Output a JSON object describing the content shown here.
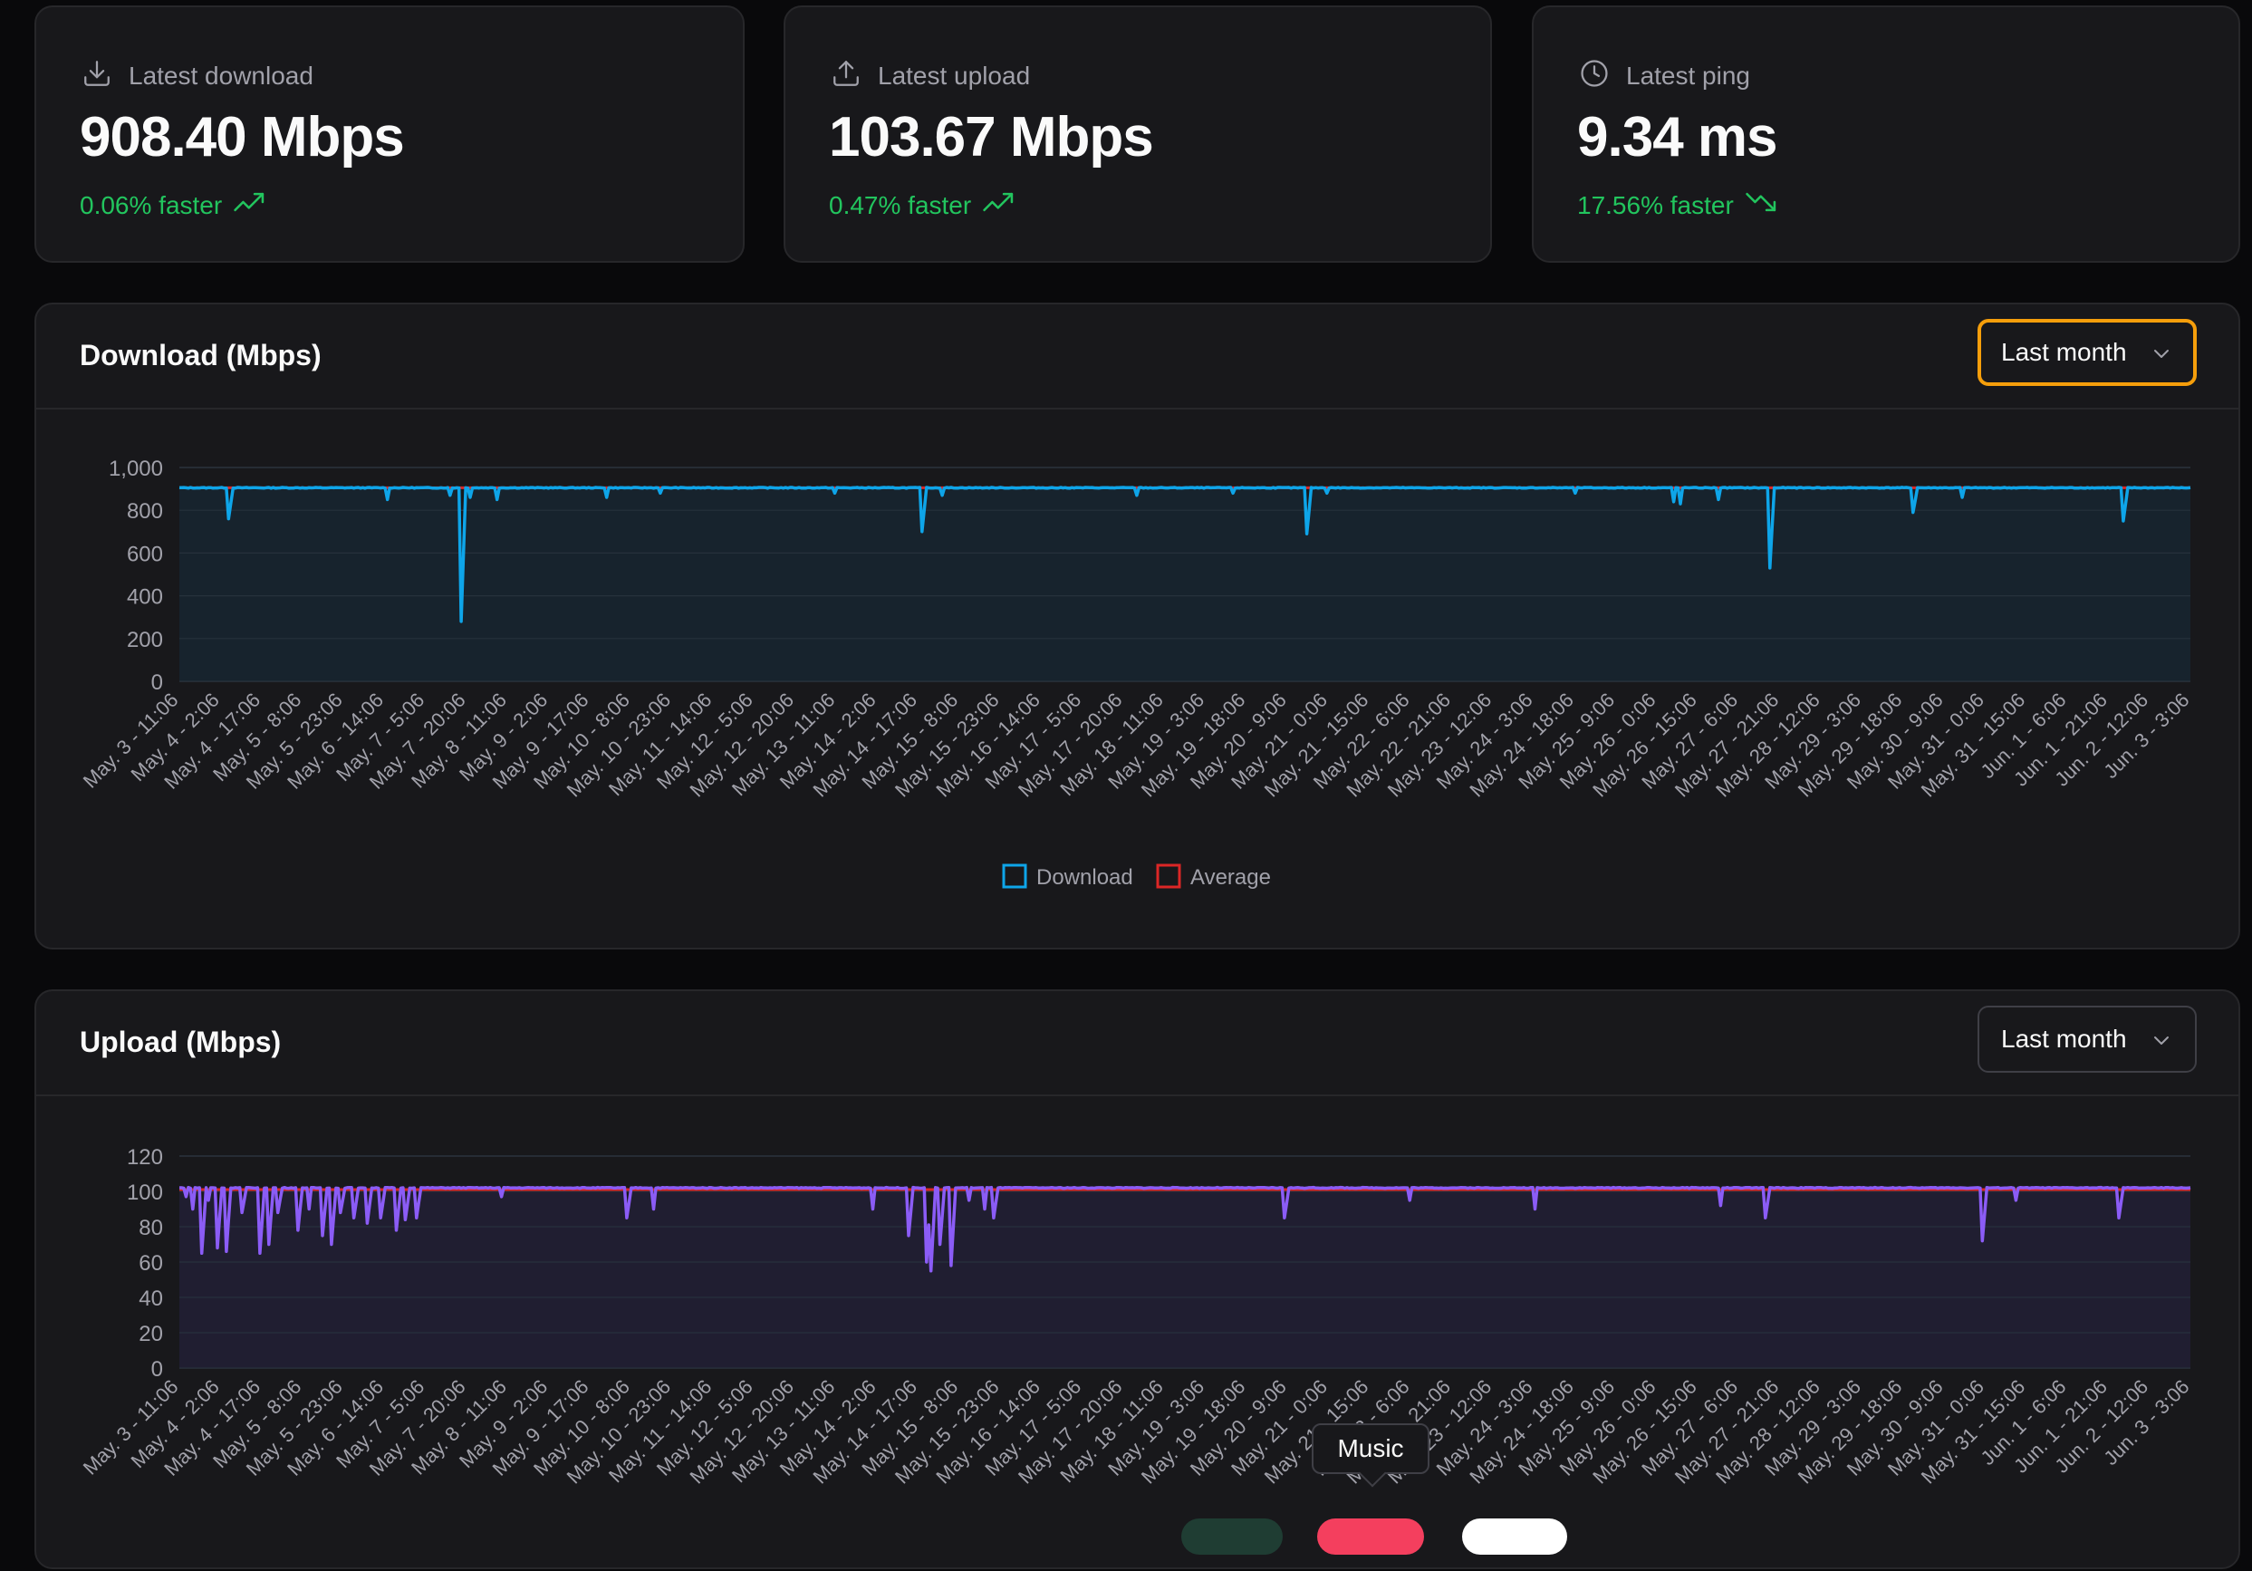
{
  "stats": [
    {
      "label": "Latest download",
      "value": "908.40 Mbps",
      "delta": "0.06% faster",
      "icon": "download-icon",
      "trend": "up"
    },
    {
      "label": "Latest upload",
      "value": "103.67 Mbps",
      "delta": "0.47% faster",
      "icon": "upload-icon",
      "trend": "up"
    },
    {
      "label": "Latest ping",
      "value": "9.34 ms",
      "delta": "17.56% faster",
      "icon": "clock-icon",
      "trend": "down"
    }
  ],
  "download_card": {
    "title": "Download (Mbps)",
    "range": "Last month"
  },
  "upload_card": {
    "title": "Upload (Mbps)",
    "range": "Last month"
  },
  "tooltip": {
    "text": "Music"
  },
  "colors": {
    "background": "#09090b",
    "card": "#18181b",
    "border": "#27272a",
    "positive": "#22c55e",
    "focus": "#f59e0b",
    "download": "#0ea5e9",
    "upload": "#8b5cf6",
    "average": "#dc2626"
  },
  "chart_data": [
    {
      "type": "line",
      "categories": [
        "May. 3 - 11:06",
        "May. 4 - 2:06",
        "May. 4 - 17:06",
        "May. 5 - 8:06",
        "May. 5 - 23:06",
        "May. 6 - 14:06",
        "May. 7 - 5:06",
        "May. 7 - 20:06",
        "May. 8 - 11:06",
        "May. 9 - 2:06",
        "May. 9 - 17:06",
        "May. 10 - 8:06",
        "May. 10 - 23:06",
        "May. 11 - 14:06",
        "May. 12 - 5:06",
        "May. 12 - 20:06",
        "May. 13 - 11:06",
        "May. 14 - 2:06",
        "May. 14 - 17:06",
        "May. 15 - 8:06",
        "May. 15 - 23:06",
        "May. 16 - 14:06",
        "May. 17 - 5:06",
        "May. 17 - 20:06",
        "May. 18 - 11:06",
        "May. 19 - 3:06",
        "May. 19 - 18:06",
        "May. 20 - 9:06",
        "May. 21 - 0:06",
        "May. 21 - 15:06",
        "May. 22 - 6:06",
        "May. 22 - 21:06",
        "May. 23 - 12:06",
        "May. 24 - 3:06",
        "May. 24 - 18:06",
        "May. 25 - 9:06",
        "May. 26 - 0:06",
        "May. 26 - 15:06",
        "May. 27 - 6:06",
        "May. 27 - 21:06",
        "May. 28 - 12:06",
        "May. 29 - 3:06",
        "May. 29 - 18:06",
        "May. 30 - 9:06",
        "May. 31 - 0:06",
        "May. 31 - 15:06",
        "Jun. 1 - 6:06",
        "Jun. 1 - 21:06",
        "Jun. 2 - 12:06",
        "Jun. 3 - 3:06"
      ],
      "series": [
        {
          "name": "Download",
          "color": "#0ea5e9",
          "baseline": 905,
          "dips": [
            [
              0.024,
              760
            ],
            [
              0.103,
              850
            ],
            [
              0.135,
              870
            ],
            [
              0.14,
              280
            ],
            [
              0.145,
              860
            ],
            [
              0.158,
              850
            ],
            [
              0.213,
              860
            ],
            [
              0.239,
              880
            ],
            [
              0.326,
              880
            ],
            [
              0.369,
              700
            ],
            [
              0.379,
              870
            ],
            [
              0.476,
              870
            ],
            [
              0.524,
              880
            ],
            [
              0.561,
              690
            ],
            [
              0.571,
              880
            ],
            [
              0.694,
              880
            ],
            [
              0.743,
              840
            ],
            [
              0.746,
              830
            ],
            [
              0.765,
              850
            ],
            [
              0.791,
              530
            ],
            [
              0.862,
              790
            ],
            [
              0.887,
              860
            ],
            [
              0.967,
              750
            ]
          ]
        },
        {
          "name": "Average",
          "color": "#dc2626",
          "value": 905
        }
      ],
      "ylim": [
        0,
        1000
      ],
      "yticks": [
        "0",
        "200",
        "400",
        "600",
        "800",
        "1,000"
      ],
      "legend": "bottom-center",
      "grid": true
    },
    {
      "type": "line",
      "categories": [
        "May. 3 - 11:06",
        "May. 4 - 2:06",
        "May. 4 - 17:06",
        "May. 5 - 8:06",
        "May. 5 - 23:06",
        "May. 6 - 14:06",
        "May. 7 - 5:06",
        "May. 7 - 20:06",
        "May. 8 - 11:06",
        "May. 9 - 2:06",
        "May. 9 - 17:06",
        "May. 10 - 8:06",
        "May. 10 - 23:06",
        "May. 11 - 14:06",
        "May. 12 - 5:06",
        "May. 12 - 20:06",
        "May. 13 - 11:06",
        "May. 14 - 2:06",
        "May. 14 - 17:06",
        "May. 15 - 8:06",
        "May. 15 - 23:06",
        "May. 16 - 14:06",
        "May. 17 - 5:06",
        "May. 17 - 20:06",
        "May. 18 - 11:06",
        "May. 19 - 3:06",
        "May. 19 - 18:06",
        "May. 20 - 9:06",
        "May. 21 - 0:06",
        "May. 21 - 15:06",
        "May. 22 - 6:06",
        "May. 22 - 21:06",
        "May. 23 - 12:06",
        "May. 24 - 3:06",
        "May. 24 - 18:06",
        "May. 25 - 9:06",
        "May. 26 - 0:06",
        "May. 26 - 15:06",
        "May. 27 - 6:06",
        "May. 27 - 21:06",
        "May. 28 - 12:06",
        "May. 29 - 3:06",
        "May. 29 - 18:06",
        "May. 30 - 9:06",
        "May. 31 - 0:06",
        "May. 31 - 15:06",
        "Jun. 1 - 6:06",
        "Jun. 1 - 21:06",
        "Jun. 2 - 12:06",
        "Jun. 3 - 3:06"
      ],
      "series": [
        {
          "name": "Upload",
          "color": "#8b5cf6",
          "baseline": 102,
          "dips": [
            [
              0.003,
              97
            ],
            [
              0.007,
              90
            ],
            [
              0.011,
              65
            ],
            [
              0.015,
              95
            ],
            [
              0.019,
              68
            ],
            [
              0.023,
              66
            ],
            [
              0.031,
              88
            ],
            [
              0.04,
              65
            ],
            [
              0.044,
              70
            ],
            [
              0.049,
              88
            ],
            [
              0.059,
              78
            ],
            [
              0.065,
              90
            ],
            [
              0.071,
              75
            ],
            [
              0.076,
              70
            ],
            [
              0.08,
              88
            ],
            [
              0.087,
              85
            ],
            [
              0.093,
              82
            ],
            [
              0.1,
              85
            ],
            [
              0.108,
              78
            ],
            [
              0.112,
              84
            ],
            [
              0.118,
              85
            ],
            [
              0.16,
              97
            ],
            [
              0.223,
              85
            ],
            [
              0.236,
              90
            ],
            [
              0.345,
              90
            ],
            [
              0.363,
              75
            ],
            [
              0.371,
              60
            ],
            [
              0.374,
              55
            ],
            [
              0.378,
              70
            ],
            [
              0.384,
              58
            ],
            [
              0.393,
              95
            ],
            [
              0.401,
              90
            ],
            [
              0.405,
              85
            ],
            [
              0.55,
              85
            ],
            [
              0.612,
              95
            ],
            [
              0.674,
              90
            ],
            [
              0.766,
              92
            ],
            [
              0.789,
              85
            ],
            [
              0.897,
              72
            ],
            [
              0.913,
              95
            ],
            [
              0.964,
              85
            ]
          ]
        },
        {
          "name": "Average",
          "color": "#dc2626",
          "value": 101
        }
      ],
      "ylim": [
        0,
        120
      ],
      "yticks": [
        "0",
        "20",
        "40",
        "60",
        "80",
        "100",
        "120"
      ],
      "legend": "none",
      "grid": true
    }
  ]
}
